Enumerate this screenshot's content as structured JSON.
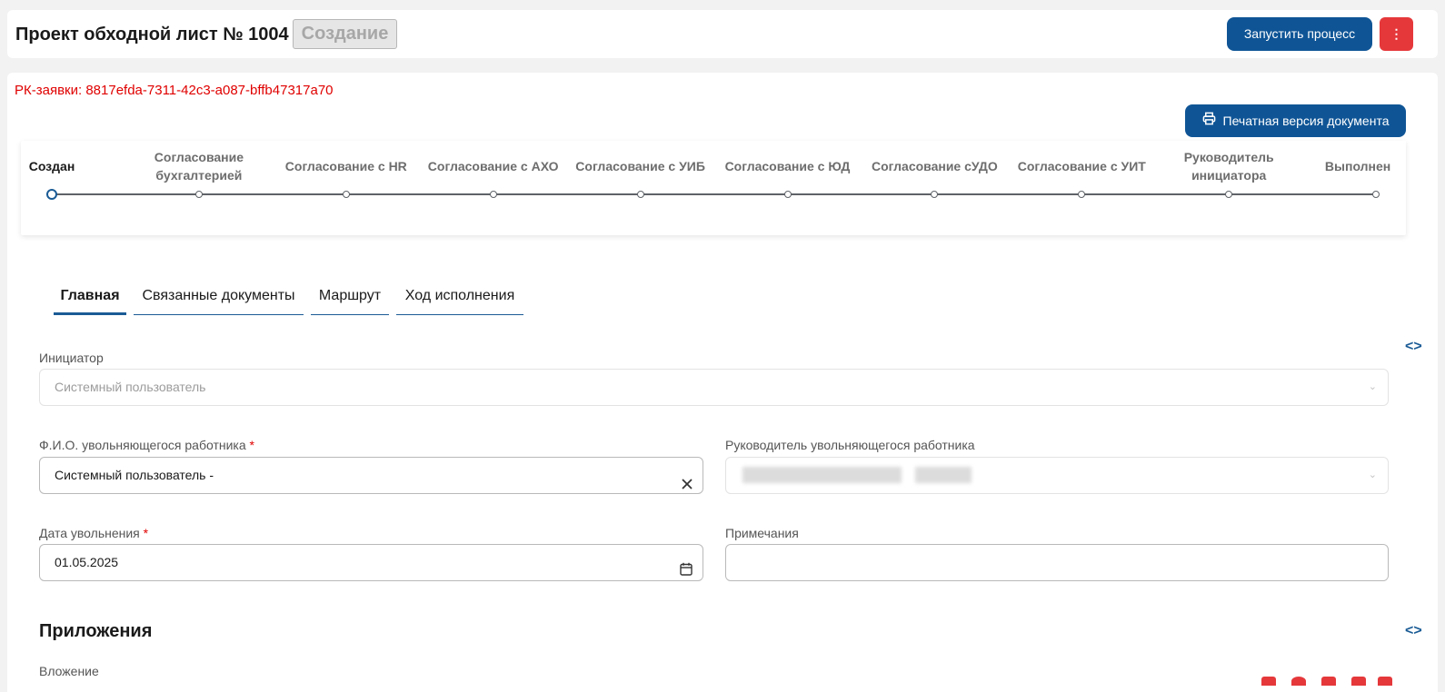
{
  "header": {
    "title": "Проект обходной лист № 1004",
    "status": "Создание",
    "run_button": "Запустить процесс",
    "more_button": "⋮"
  },
  "card": {
    "pk_text": "РК-заявки: 8817efda-7311-42c3-a087-bffb47317a70",
    "print_button": "Печатная версия документа"
  },
  "steps": [
    {
      "label": "Создан",
      "active": true
    },
    {
      "label": "Согласование бухгалтерией",
      "active": false
    },
    {
      "label": "Согласование с HR",
      "active": false
    },
    {
      "label": "Согласование с АХО",
      "active": false
    },
    {
      "label": "Согласование с УИБ",
      "active": false
    },
    {
      "label": "Согласование с ЮД",
      "active": false
    },
    {
      "label": "Согласование сУДО",
      "active": false
    },
    {
      "label": "Согласование с УИТ",
      "active": false
    },
    {
      "label": "Руководитель инициатора",
      "active": false
    },
    {
      "label": "Выполнен",
      "active": false
    }
  ],
  "tabs": [
    {
      "label": "Главная",
      "active": true
    },
    {
      "label": "Связанные документы",
      "active": false
    },
    {
      "label": "Маршрут",
      "active": false
    },
    {
      "label": "Ход исполнения",
      "active": false
    }
  ],
  "form": {
    "initiator": {
      "label": "Инициатор",
      "value": "Системный пользователь"
    },
    "employee": {
      "label": "Ф.И.О. увольняющегося работника",
      "required_mark": "*",
      "value": "Системный пользователь -"
    },
    "manager": {
      "label": "Руководитель увольняющегося работника",
      "value": ""
    },
    "dismissal_date": {
      "label": "Дата увольнения",
      "required_mark": "*",
      "value": "01.05.2025"
    },
    "notes": {
      "label": "Примечания",
      "value": ""
    }
  },
  "attachments": {
    "title": "Приложения",
    "attachment_label": "Вложение"
  },
  "icons": {
    "code_toggle": "<>",
    "accent_color": "#0f5596",
    "danger_color": "#e5383b"
  }
}
